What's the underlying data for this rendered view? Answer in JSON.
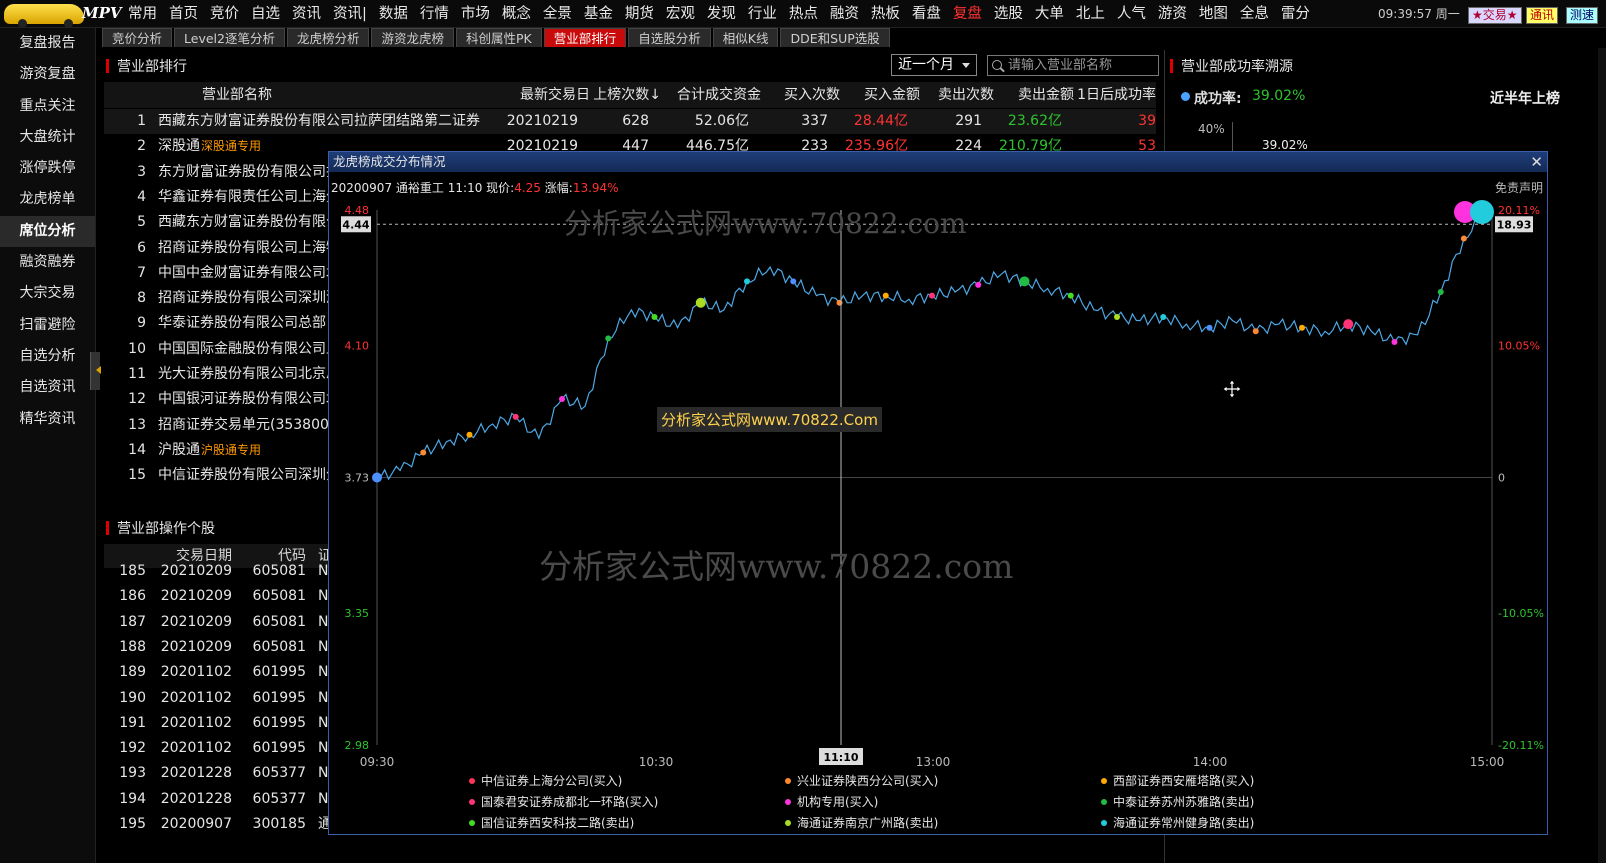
{
  "app": {
    "brand": "MPV",
    "clock": "09:39:57 周一",
    "btn_trade": "★交易★",
    "btn_tongxun": "通讯",
    "btn_cesu": "测速"
  },
  "nav": [
    "常用",
    "首页",
    "竞价",
    "自选",
    "资讯",
    "资讯|",
    "数据",
    "行情",
    "市场",
    "概念",
    "全景",
    "基金",
    "期货",
    "宏观",
    "发现",
    "行业",
    "热点",
    "融资",
    "热板",
    "看盘",
    "复盘",
    "选股",
    "大单",
    "北上",
    "人气",
    "游资",
    "地图",
    "全息",
    "雷分"
  ],
  "nav_active": "复盘",
  "sidebar": [
    "复盘报告",
    "游资复盘",
    "重点关注",
    "大盘统计",
    "涨停跌停",
    "龙虎榜单",
    "席位分析",
    "融资融券",
    "大宗交易",
    "扫雷避险",
    "自选分析",
    "自选资讯",
    "精华资讯"
  ],
  "sidebar_active": "席位分析",
  "subtabs": [
    "竞价分析",
    "Level2逐笔分析",
    "龙虎榜分析",
    "游资龙虎榜",
    "科创属性PK",
    "营业部排行",
    "自选股分析",
    "相似K线",
    "DDE和SUP选股"
  ],
  "subtab_active": "营业部排行",
  "panel1": {
    "title": "营业部排行",
    "period": "近一个月",
    "search_placeholder": "请输入营业部名称",
    "headers": [
      "",
      "营业部名称",
      "最新交易日",
      "上榜次数↓",
      "合计成交资金",
      "买入次数",
      "买入金额",
      "卖出次数",
      "卖出金额",
      "1日后成功率"
    ],
    "rows": [
      {
        "n": "1",
        "name": "西藏东方财富证券股份有限公司拉萨团结路第二证券",
        "tag": "",
        "date": "20210219",
        "cnt": "628",
        "tot": "52.06亿",
        "buy": "337",
        "buyamt": "28.44亿",
        "sell": "291",
        "sellamt": "23.62亿",
        "d1": "39"
      },
      {
        "n": "2",
        "name": "深股通专用",
        "tag": "深股通专用",
        "date": "20210219",
        "cnt": "447",
        "tot": "446.75亿",
        "buy": "233",
        "buyamt": "235.96亿",
        "sell": "224",
        "sellamt": "210.79亿",
        "d1": "53"
      },
      {
        "n": "3",
        "name": "东方财富证券股份有限公司拉",
        "tag": "",
        "date": "",
        "cnt": "",
        "tot": "",
        "buy": "",
        "buyamt": "",
        "sell": "",
        "sellamt": "",
        "d1": ""
      },
      {
        "n": "4",
        "name": "华鑫证券有限责任公司上海分",
        "tag": "",
        "date": "",
        "cnt": "",
        "tot": "",
        "buy": "",
        "buyamt": "",
        "sell": "",
        "sellamt": "",
        "d1": ""
      },
      {
        "n": "5",
        "name": "西藏东方财富证券股份有限公",
        "tag": "",
        "date": "",
        "cnt": "",
        "tot": "",
        "buy": "",
        "buyamt": "",
        "sell": "",
        "sellamt": "",
        "d1": ""
      },
      {
        "n": "6",
        "name": "招商证券股份有限公司上海牡",
        "tag": "",
        "date": "",
        "cnt": "",
        "tot": "",
        "buy": "",
        "buyamt": "",
        "sell": "",
        "sellamt": "",
        "d1": ""
      },
      {
        "n": "7",
        "name": "中国中金财富证券有限公司北",
        "tag": "",
        "date": "",
        "cnt": "",
        "tot": "",
        "buy": "",
        "buyamt": "",
        "sell": "",
        "sellamt": "",
        "d1": ""
      },
      {
        "n": "8",
        "name": "招商证券股份有限公司深圳深",
        "tag": "",
        "date": "",
        "cnt": "",
        "tot": "",
        "buy": "",
        "buyamt": "",
        "sell": "",
        "sellamt": "",
        "d1": ""
      },
      {
        "n": "9",
        "name": "华泰证券股份有限公司总部",
        "tag": "",
        "date": "",
        "cnt": "",
        "tot": "",
        "buy": "",
        "buyamt": "",
        "sell": "",
        "sellamt": "",
        "d1": ""
      },
      {
        "n": "10",
        "name": "中国国际金融股份有限公司上",
        "tag": "",
        "date": "",
        "cnt": "",
        "tot": "",
        "buy": "",
        "buyamt": "",
        "sell": "",
        "sellamt": "",
        "d1": ""
      },
      {
        "n": "11",
        "name": "光大证券股份有限公司北京总",
        "tag": "",
        "date": "",
        "cnt": "",
        "tot": "",
        "buy": "",
        "buyamt": "",
        "sell": "",
        "sellamt": "",
        "d1": ""
      },
      {
        "n": "12",
        "name": "中国银河证券股份有限公司北",
        "tag": "",
        "date": "",
        "cnt": "",
        "tot": "",
        "buy": "",
        "buyamt": "",
        "sell": "",
        "sellamt": "",
        "d1": ""
      },
      {
        "n": "13",
        "name": "招商证券交易单元(353800)",
        "tag": "",
        "date": "",
        "cnt": "",
        "tot": "",
        "buy": "",
        "buyamt": "",
        "sell": "",
        "sellamt": "",
        "d1": ""
      },
      {
        "n": "14",
        "name": "沪股通专用",
        "tag": "沪股通专用",
        "date": "",
        "cnt": "",
        "tot": "",
        "buy": "",
        "buyamt": "",
        "sell": "",
        "sellamt": "",
        "d1": ""
      },
      {
        "n": "15",
        "name": "中信证券股份有限公司深圳分",
        "tag": "",
        "date": "",
        "cnt": "",
        "tot": "",
        "buy": "",
        "buyamt": "",
        "sell": "",
        "sellamt": "",
        "d1": ""
      }
    ]
  },
  "panel2": {
    "title": "营业部操作个股",
    "headers": [
      "",
      "交易日期",
      "代码",
      "证"
    ],
    "rows": [
      {
        "n": "185",
        "d": "20210209",
        "c": "605081",
        "x": "N"
      },
      {
        "n": "186",
        "d": "20210209",
        "c": "605081",
        "x": "N"
      },
      {
        "n": "187",
        "d": "20210209",
        "c": "605081",
        "x": "N"
      },
      {
        "n": "188",
        "d": "20210209",
        "c": "605081",
        "x": "N"
      },
      {
        "n": "189",
        "d": "20201102",
        "c": "601995",
        "x": "N"
      },
      {
        "n": "190",
        "d": "20201102",
        "c": "601995",
        "x": "N"
      },
      {
        "n": "191",
        "d": "20201102",
        "c": "601995",
        "x": "N"
      },
      {
        "n": "192",
        "d": "20201102",
        "c": "601995",
        "x": "N"
      },
      {
        "n": "193",
        "d": "20201228",
        "c": "605377",
        "x": "N"
      },
      {
        "n": "194",
        "d": "20201228",
        "c": "605377",
        "x": "N"
      },
      {
        "n": "195",
        "d": "20200907",
        "c": "300185",
        "x": "通"
      }
    ]
  },
  "panel3": {
    "title": "营业部成功率溯源",
    "rate_label": "成功率:",
    "rate_value": "39.02%",
    "half_year": "近半年上榜",
    "axis_40": "40%",
    "bar_value": "39.02%"
  },
  "modal": {
    "title": "龙虎榜成交分布情况",
    "date": "20200907",
    "stock": "通裕重工",
    "time": "11:10",
    "price_label": "现价:",
    "price": "4.25",
    "change_label": "涨幅:",
    "change": "13.94%",
    "disclaimer": "免责声明",
    "watermark1": "分析家公式网www.70822.com",
    "watermark2": "分析家公式网www.70822.com",
    "watermark3": "分析家公式网www.70822.Com",
    "y_left": [
      "4.48",
      "4.10",
      "3.73",
      "3.35",
      "2.98"
    ],
    "y_right": [
      "20.11%",
      "10.05%",
      "0",
      "-10.05%",
      "-20.11%"
    ],
    "x_ticks": [
      "09:30",
      "10:30",
      "13:00",
      "14:00",
      "15:00"
    ],
    "cursor_price": "4.44",
    "cursor_right": "18.93",
    "cursor_time": "11:10",
    "legend": [
      {
        "name": "中信证券上海分公司(买入)",
        "color": "#ff3355"
      },
      {
        "name": "兴业证券陕西分公司(买入)",
        "color": "#ff8833"
      },
      {
        "name": "西部证券西安雁塔路(买入)",
        "color": "#ffaa00"
      },
      {
        "name": "国泰君安证券成都北一环路(买入)",
        "color": "#ff3377"
      },
      {
        "name": "机构专用(买入)",
        "color": "#ff33dd"
      },
      {
        "name": "中泰证券苏州苏雅路(卖出)",
        "color": "#22bb44"
      },
      {
        "name": "国信证券西安科技二路(卖出)",
        "color": "#44dd22"
      },
      {
        "name": "海通证券南京广州路(卖出)",
        "color": "#aadd22"
      },
      {
        "name": "海通证券常州健身路(卖出)",
        "color": "#22ccdd"
      }
    ]
  },
  "chart_data": {
    "type": "line",
    "title": "龙虎榜成交分布情况",
    "xlabel": "",
    "ylabel": "",
    "ylim": [
      2.98,
      4.48
    ],
    "x": [
      "09:30",
      "09:35",
      "09:40",
      "09:45",
      "09:50",
      "09:55",
      "10:00",
      "10:05",
      "10:10",
      "10:15",
      "10:20",
      "10:25",
      "10:30",
      "10:35",
      "10:40",
      "10:45",
      "10:50",
      "10:55",
      "11:00",
      "11:05",
      "11:10",
      "11:15",
      "11:20",
      "11:25",
      "11:30",
      "13:05",
      "13:10",
      "13:15",
      "13:20",
      "13:25",
      "13:30",
      "13:35",
      "13:40",
      "13:45",
      "13:50",
      "13:55",
      "14:00",
      "14:05",
      "14:10",
      "14:15",
      "14:20",
      "14:25",
      "14:30",
      "14:35",
      "14:40",
      "14:45",
      "14:50",
      "14:55",
      "15:00"
    ],
    "series": [
      {
        "values": [
          3.73,
          3.75,
          3.8,
          3.83,
          3.85,
          3.88,
          3.9,
          3.84,
          3.95,
          3.93,
          4.12,
          4.2,
          4.18,
          4.15,
          4.22,
          4.2,
          4.28,
          4.32,
          4.28,
          4.24,
          4.22,
          4.24,
          4.24,
          4.23,
          4.24,
          4.25,
          4.27,
          4.3,
          4.28,
          4.26,
          4.24,
          4.2,
          4.18,
          4.17,
          4.18,
          4.16,
          4.15,
          4.17,
          4.14,
          4.16,
          4.15,
          4.14,
          4.16,
          4.14,
          4.11,
          4.13,
          4.25,
          4.4,
          4.48
        ]
      }
    ],
    "y_right_ticks": [
      "20.11%",
      "10.05%",
      "0",
      "-10.05%",
      "-20.11%"
    ],
    "grid": false
  }
}
